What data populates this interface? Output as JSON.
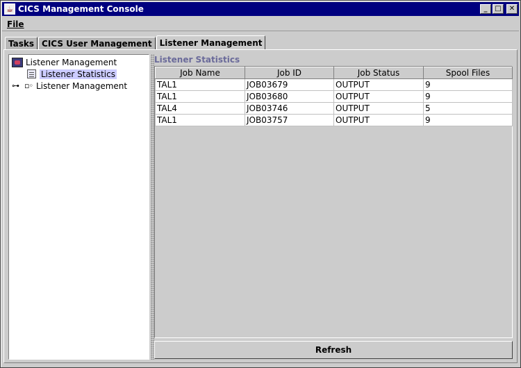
{
  "window": {
    "title": "CICS Management Console"
  },
  "menu": {
    "file": "File"
  },
  "tabs": [
    {
      "label": "Tasks"
    },
    {
      "label": "CICS User Management"
    },
    {
      "label": "Listener Management"
    }
  ],
  "tree": {
    "root": "Listener Management",
    "child_selected": "Listener Statistics",
    "node": "Listener Management"
  },
  "panel": {
    "title": "Listener Statistics"
  },
  "table": {
    "columns": [
      "Job Name",
      "Job ID",
      "Job Status",
      "Spool Files"
    ],
    "rows": [
      [
        "TAL1",
        "JOB03679",
        "OUTPUT",
        "9"
      ],
      [
        "TAL1",
        "JOB03680",
        "OUTPUT",
        "9"
      ],
      [
        "TAL4",
        "JOB03746",
        "OUTPUT",
        "5"
      ],
      [
        "TAL1",
        "JOB03757",
        "OUTPUT",
        "9"
      ]
    ]
  },
  "buttons": {
    "refresh": "Refresh"
  },
  "icons": {
    "app": "coffee-cup-icon",
    "minimize": "minimize-icon",
    "maximize": "maximize-icon",
    "close": "close-icon"
  }
}
